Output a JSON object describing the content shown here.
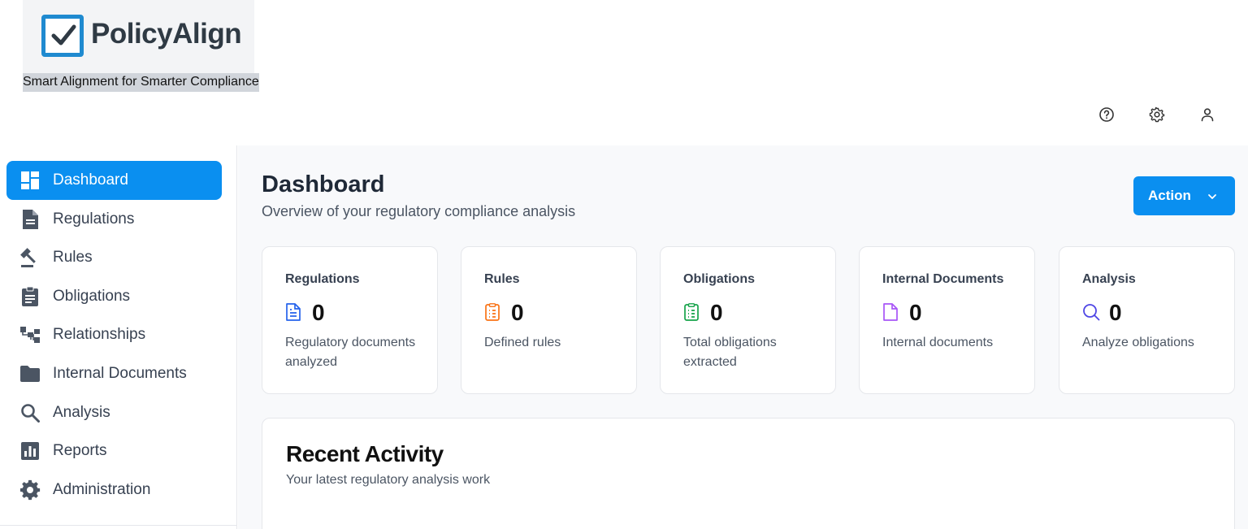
{
  "brand": {
    "name": "PolicyAlign",
    "tagline": "Smart Alignment for Smarter Compliance",
    "logo_icon": "checkbox-icon",
    "accent": "#0a8ff0"
  },
  "header_icons": [
    {
      "name": "help-icon"
    },
    {
      "name": "gear-icon"
    },
    {
      "name": "user-icon"
    }
  ],
  "sidebar": {
    "items": [
      {
        "label": "Dashboard",
        "icon": "dashboard-icon",
        "active": true
      },
      {
        "label": "Regulations",
        "icon": "document-icon"
      },
      {
        "label": "Rules",
        "icon": "gavel-icon"
      },
      {
        "label": "Obligations",
        "icon": "clipboard-icon"
      },
      {
        "label": "Relationships",
        "icon": "hierarchy-icon"
      },
      {
        "label": "Internal Documents",
        "icon": "folder-icon"
      },
      {
        "label": "Analysis",
        "icon": "search-icon"
      },
      {
        "label": "Reports",
        "icon": "bar-chart-icon"
      },
      {
        "label": "Administration",
        "icon": "cog-icon"
      }
    ]
  },
  "main": {
    "title": "Dashboard",
    "subtitle": "Overview of your regulatory compliance analysis",
    "action_label": "Action",
    "cards": [
      {
        "title": "Regulations",
        "value": "0",
        "desc": "Regulatory documents analyzed",
        "icon": "file-text-icon",
        "color": "#2563eb"
      },
      {
        "title": "Rules",
        "value": "0",
        "desc": "Defined rules",
        "icon": "list-icon",
        "color": "#f97316"
      },
      {
        "title": "Obligations",
        "value": "0",
        "desc": "Total obligations extracted",
        "icon": "clipboard-list-icon",
        "color": "#16a34a"
      },
      {
        "title": "Internal Documents",
        "value": "0",
        "desc": "Internal documents",
        "icon": "file-icon",
        "color": "#a855f7"
      },
      {
        "title": "Analysis",
        "value": "0",
        "desc": "Analyze obligations",
        "icon": "search-icon",
        "color": "#4f46e5"
      }
    ],
    "recent": {
      "title": "Recent Activity",
      "subtitle": "Your latest regulatory analysis work"
    }
  }
}
